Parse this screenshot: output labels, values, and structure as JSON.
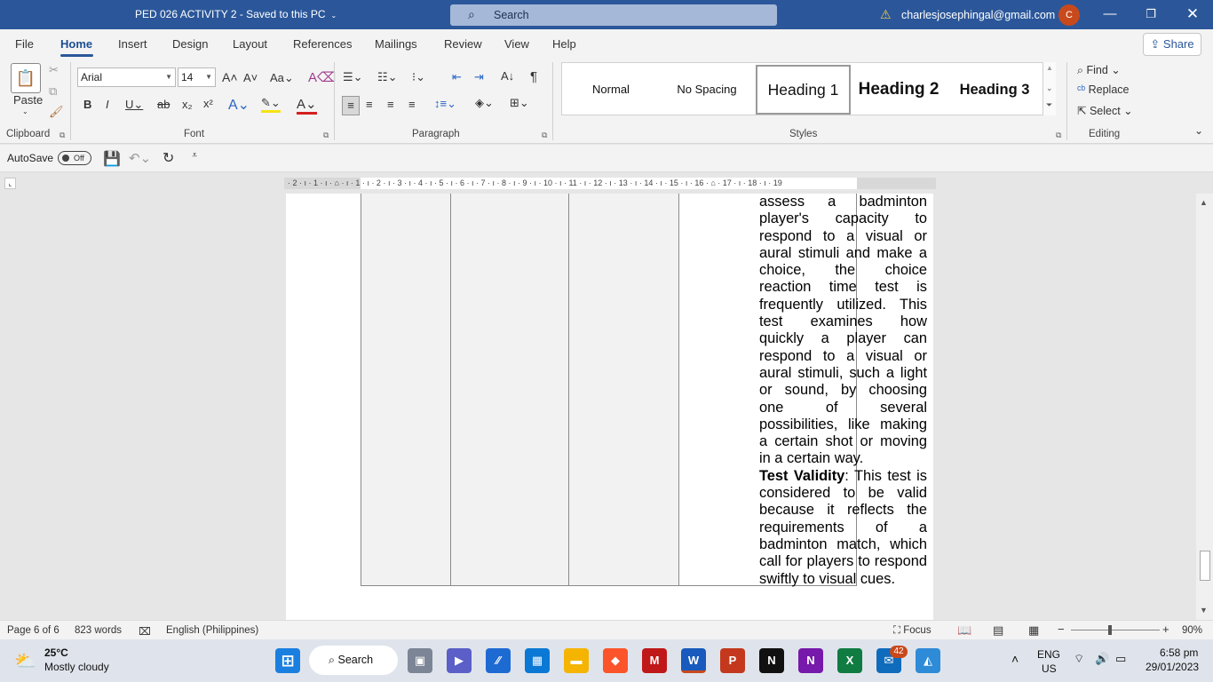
{
  "titlebar": {
    "doc_title": "PED 026 ACTIVITY 2  -  Saved to this PC",
    "search_placeholder": "Search",
    "account_email": "charlesjosephingal@gmail.com",
    "avatar_initial": "C"
  },
  "menu": {
    "tabs": [
      "File",
      "Home",
      "Insert",
      "Design",
      "Layout",
      "References",
      "Mailings",
      "Review",
      "View",
      "Help"
    ],
    "active": "Home",
    "share_label": "Share"
  },
  "ribbon": {
    "clipboard": {
      "label": "Clipboard",
      "paste_label": "Paste"
    },
    "font": {
      "label": "Font",
      "font_name": "Arial",
      "font_size": "14"
    },
    "paragraph": {
      "label": "Paragraph"
    },
    "styles": {
      "label": "Styles",
      "items": [
        "Normal",
        "No Spacing",
        "Heading 1",
        "Heading 2",
        "Heading 3"
      ],
      "selected": "Heading 1"
    },
    "editing": {
      "label": "Editing",
      "find": "Find",
      "replace": "Replace",
      "select": "Select"
    }
  },
  "qat": {
    "autosave_label": "AutoSave",
    "autosave_state": "Off"
  },
  "ruler": {
    "text": "· 2 · ı · 1 · ı · ⌂ · ı · 1 · ı · 2 · ı · 3 · ı · 4 · ı · 5 · ı · 6 · ı · 7 · ı · 8 · ı · 9 · ı · 10 · ı · 11 · ı · 12 · ı · 13 · ı · 14 · ı · 15 · ı · 16 · ⌂ · 17 · ı · 18 · ı · 19"
  },
  "document": {
    "lines": [
      {
        "text": "assess a badminton",
        "justify": true
      },
      {
        "text": "player's capacity to",
        "justify": true
      },
      {
        "text": "respond to a visual or",
        "justify": true
      },
      {
        "text": "aural stimuli and make a",
        "justify": true
      },
      {
        "text": "choice, the choice",
        "justify": true
      },
      {
        "text": "reaction time test is",
        "justify": true
      },
      {
        "text": "frequently utilized. This",
        "justify": true
      },
      {
        "text": "test examines how",
        "justify": true
      },
      {
        "text": "quickly a player can",
        "justify": true
      },
      {
        "text": "respond to a visual or",
        "justify": true
      },
      {
        "text": "aural stimuli, such a light",
        "justify": true
      },
      {
        "text": "or sound, by choosing",
        "justify": true
      },
      {
        "text": "one of several",
        "justify": true
      },
      {
        "text": "possibilities, like making",
        "justify": true
      },
      {
        "text": "a certain shot or moving",
        "justify": true
      },
      {
        "text": "in a certain way.",
        "justify": false
      }
    ],
    "validity_heading": "Test Validity",
    "validity_first_rest": ": This test is",
    "validity_lines": [
      {
        "text": "considered to be valid",
        "justify": true
      },
      {
        "text": "because it reflects the",
        "justify": true
      },
      {
        "text": "requirements of a",
        "justify": true
      },
      {
        "text": "badminton match, which",
        "justify": true
      },
      {
        "text": "call for players to respond",
        "justify": true
      },
      {
        "text": "swiftly to visual cues.",
        "justify": false
      }
    ]
  },
  "status": {
    "page": "Page 6 of 6",
    "words": "823 words",
    "language": "English (Philippines)",
    "focus": "Focus",
    "zoom": "90%"
  },
  "taskbar": {
    "temperature": "25°C",
    "weather": "Mostly cloudy",
    "search_label": "Search",
    "badge_count": "42",
    "lang": "ENG",
    "region": "US",
    "time": "6:58 pm",
    "date": "29/01/2023"
  }
}
